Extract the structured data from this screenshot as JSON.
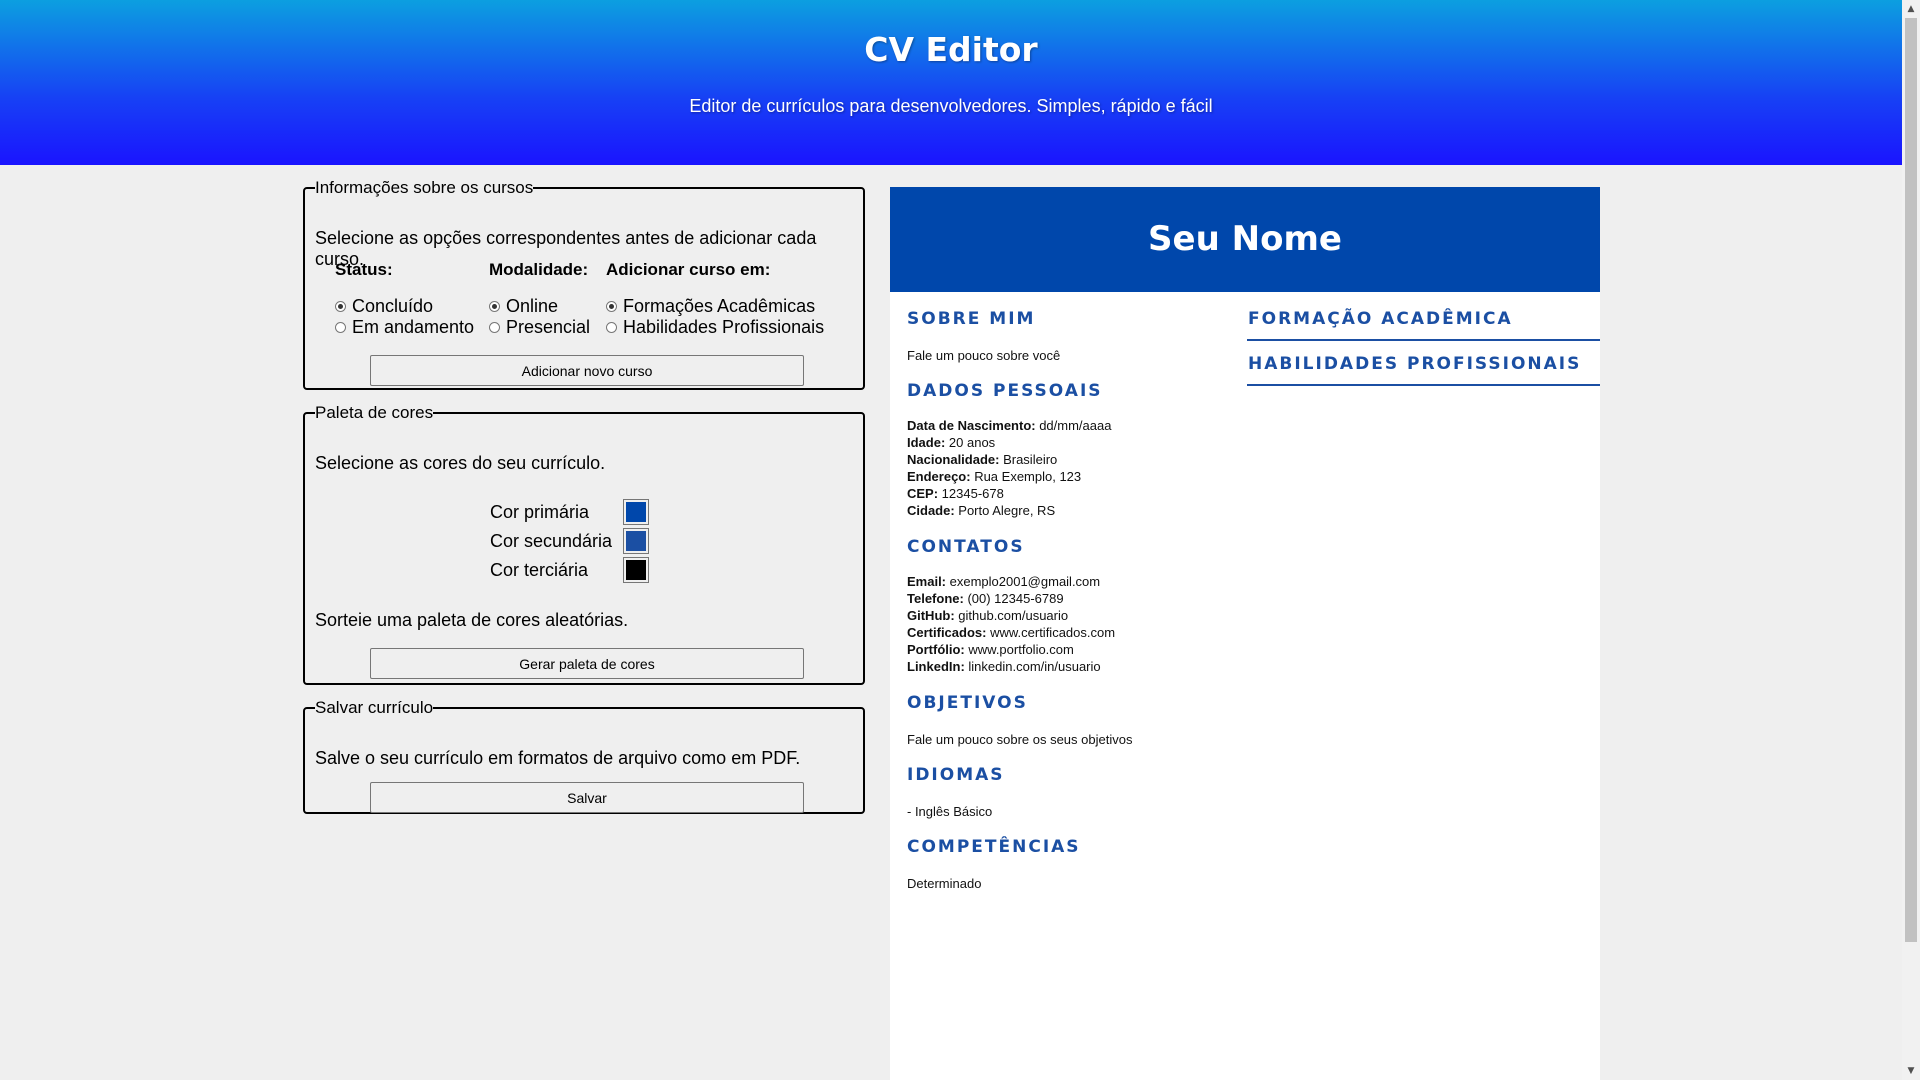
{
  "header": {
    "title": "CV Editor",
    "subtitle": "Editor de currículos para desenvolvedores. Simples, rápido e fácil"
  },
  "courses": {
    "legend": "Informações sobre os cursos",
    "description": "Selecione as opções correspondentes antes de adicionar cada curso.",
    "status": {
      "heading": "Status:",
      "options": [
        "Concluído",
        "Em andamento"
      ],
      "selected": "Concluído"
    },
    "modality": {
      "heading": "Modalidade:",
      "options": [
        "Online",
        "Presencial"
      ],
      "selected": "Online"
    },
    "target": {
      "heading": "Adicionar curso em:",
      "options": [
        "Formações Acadêmicas",
        "Habilidades Profissionais"
      ],
      "selected": "Formações Acadêmicas"
    },
    "button": "Adicionar novo curso"
  },
  "palette": {
    "legend": "Paleta de cores",
    "description": "Selecione as cores do seu currículo.",
    "colors": [
      {
        "label": "Cor primária",
        "value": "#0047ab"
      },
      {
        "label": "Cor secundária",
        "value": "#1b4fa3"
      },
      {
        "label": "Cor terciária",
        "value": "#000000"
      }
    ],
    "random_text": "Sorteie uma paleta de cores aleatórias.",
    "button": "Gerar paleta de cores"
  },
  "save": {
    "legend": "Salvar currículo",
    "description": "Salve o seu currículo em formatos de arquivo como em PDF.",
    "button": "Salvar"
  },
  "cv": {
    "name": "Seu Nome",
    "about": {
      "title": "SOBRE MIM",
      "text": "Fale um pouco sobre você"
    },
    "personal": {
      "title": "DADOS PESSOAIS",
      "fields": [
        {
          "label": "Data de Nascimento:",
          "value": " dd/mm/aaaa"
        },
        {
          "label": "Idade:",
          "value": " 20 anos"
        },
        {
          "label": "Nacionalidade:",
          "value": " Brasileiro"
        },
        {
          "label": "Endereço:",
          "value": " Rua Exemplo, 123"
        },
        {
          "label": "CEP:",
          "value": " 12345-678"
        },
        {
          "label": "Cidade:",
          "value": " Porto Alegre, RS"
        }
      ]
    },
    "contacts": {
      "title": "CONTATOS",
      "fields": [
        {
          "label": "Email:",
          "value": " exemplo2001@gmail.com"
        },
        {
          "label": "Telefone:",
          "value": " (00) 12345-6789"
        },
        {
          "label": "GitHub:",
          "value": " github.com/usuario"
        },
        {
          "label": "Certificados:",
          "value": " www.certificados.com"
        },
        {
          "label": "Portfólio:",
          "value": " www.portfolio.com"
        },
        {
          "label": "LinkedIn:",
          "value": " linkedin.com/in/usuario"
        }
      ]
    },
    "objectives": {
      "title": "OBJETIVOS",
      "text": "Fale um pouco sobre os seus objetivos"
    },
    "languages": {
      "title": "IDIOMAS",
      "text": "- Inglês Básico"
    },
    "skills": {
      "title": "COMPETÊNCIAS",
      "text": "Determinado"
    },
    "education": {
      "title": "FORMAÇÃO ACADÊMICA"
    },
    "professional": {
      "title": "HABILIDADES PROFISSIONAIS"
    }
  }
}
